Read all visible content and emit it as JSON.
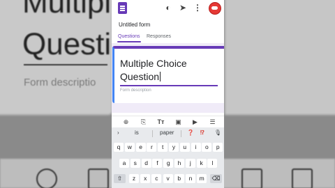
{
  "background": {
    "title_text": "Multiple\nQuestion",
    "desc_text": "Form descriptio"
  },
  "appbar": {
    "icons": [
      "forms-logo-icon",
      "palette-icon",
      "send-icon",
      "more-vert-icon",
      "avatar"
    ],
    "accent": "#673ab7"
  },
  "form": {
    "title": "Untitled form",
    "tabs": [
      {
        "label": "Questions",
        "active": true
      },
      {
        "label": "Responses",
        "active": false
      }
    ],
    "question_title": "Multiple Choice Question",
    "description_placeholder": "Form description"
  },
  "insert_toolbar": {
    "icons": [
      "add-circle-icon",
      "import-icon",
      "title-text-icon",
      "image-icon",
      "video-icon",
      "section-icon"
    ]
  },
  "keyboard": {
    "suggestions": [
      "is",
      "paper"
    ],
    "suggestion_icons": [
      "expand-icon",
      "question-mark-icon",
      "question-exclaim-icon",
      "mic-icon"
    ],
    "row1": [
      "q",
      "w",
      "e",
      "r",
      "t",
      "y",
      "u",
      "i",
      "o",
      "p"
    ],
    "row2": [
      "a",
      "s",
      "d",
      "f",
      "g",
      "h",
      "j",
      "k",
      "l"
    ],
    "row3": [
      "z",
      "x",
      "c",
      "v",
      "b",
      "n",
      "m"
    ]
  }
}
